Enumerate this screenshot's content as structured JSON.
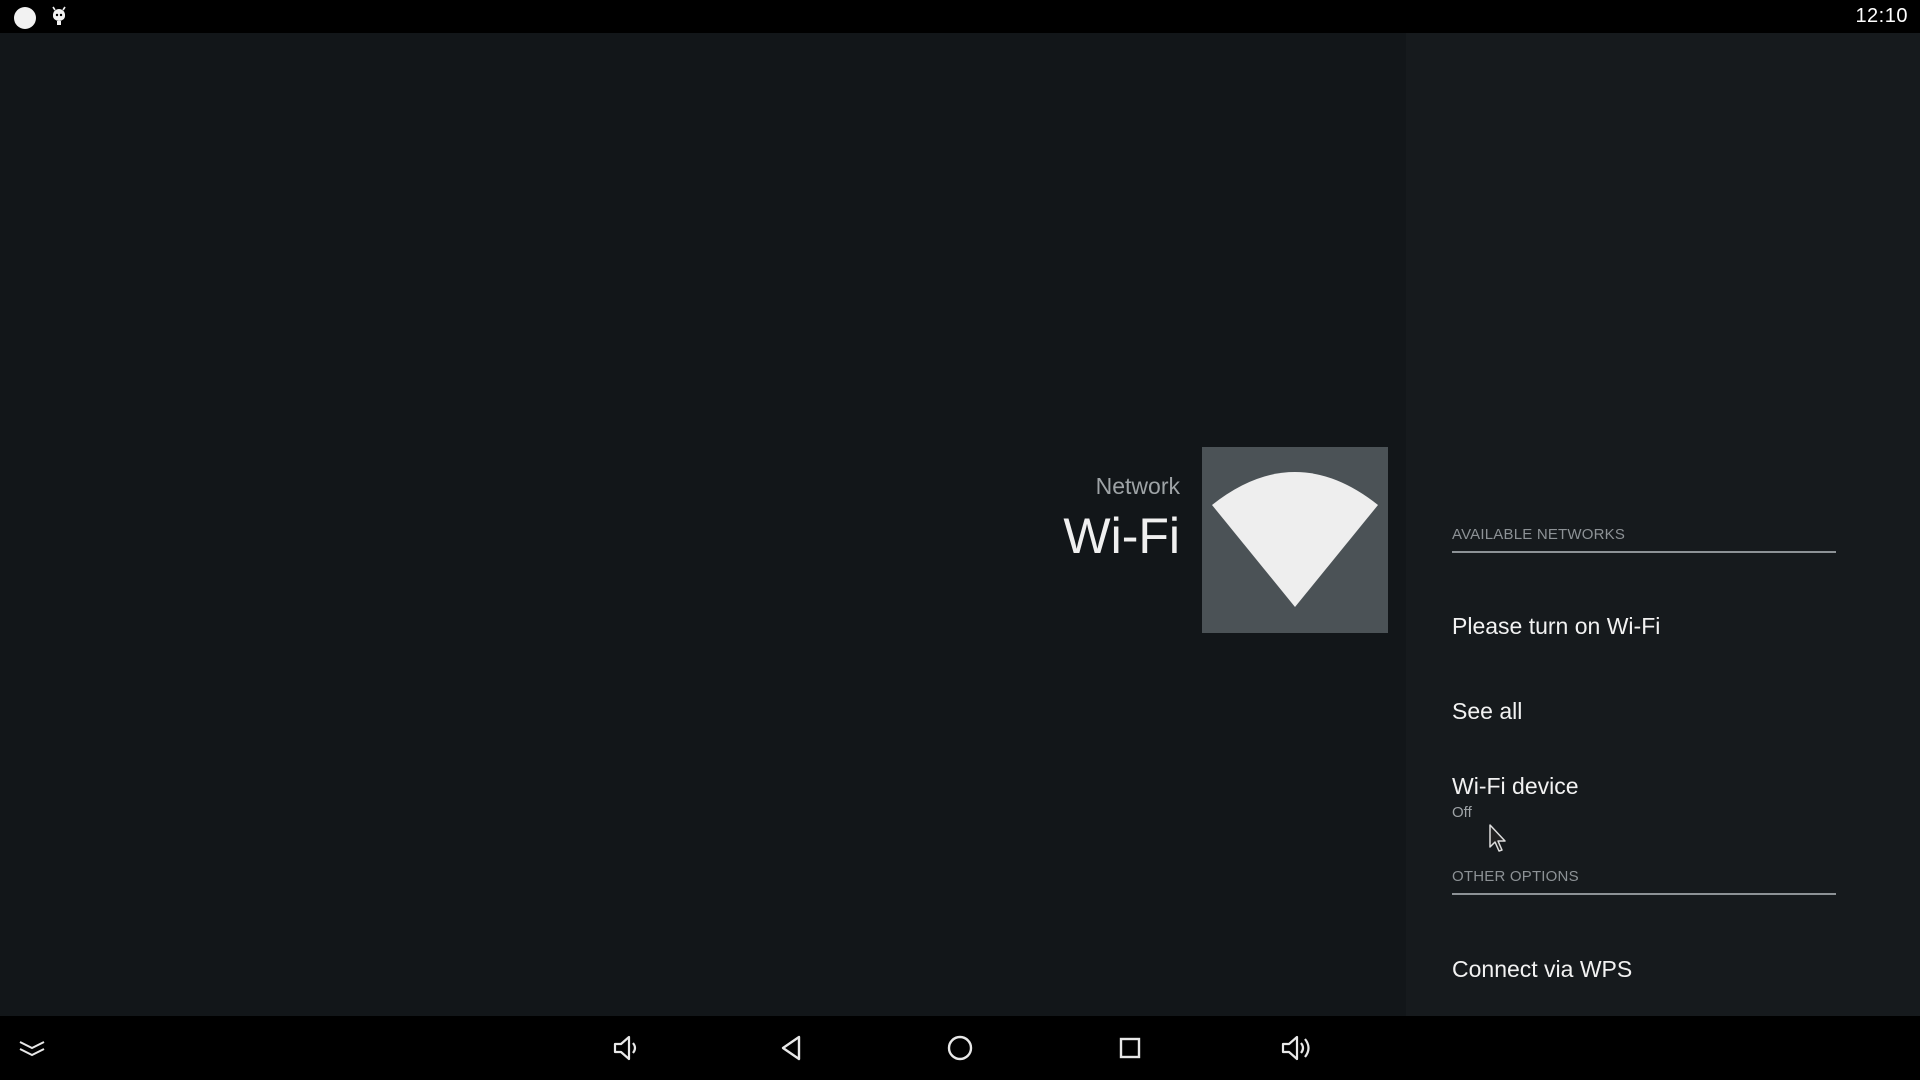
{
  "status_bar": {
    "time": "12:10",
    "icons": [
      "notification-dot-icon",
      "android-debug-icon"
    ]
  },
  "header": {
    "breadcrumb": "Network",
    "title": "Wi-Fi",
    "tile_icon": "wifi-icon"
  },
  "sections": {
    "available_networks": "AVAILABLE NETWORKS",
    "other_options": "OTHER OPTIONS"
  },
  "items": {
    "turn_on_wifi": "Please turn on Wi-Fi",
    "see_all": "See all",
    "wifi_device": "Wi-Fi device",
    "wifi_device_status": "Off",
    "connect_wps": "Connect via WPS"
  },
  "nav_bar": {
    "buttons": [
      "collapse-icon",
      "volume-down-icon",
      "back-icon",
      "home-icon",
      "recents-icon",
      "volume-up-icon"
    ]
  },
  "colors": {
    "background": "#121619",
    "panel": "#161a1d",
    "tile": "#4b5256",
    "text": "#f2f2f2",
    "muted": "#9ea3a6"
  }
}
